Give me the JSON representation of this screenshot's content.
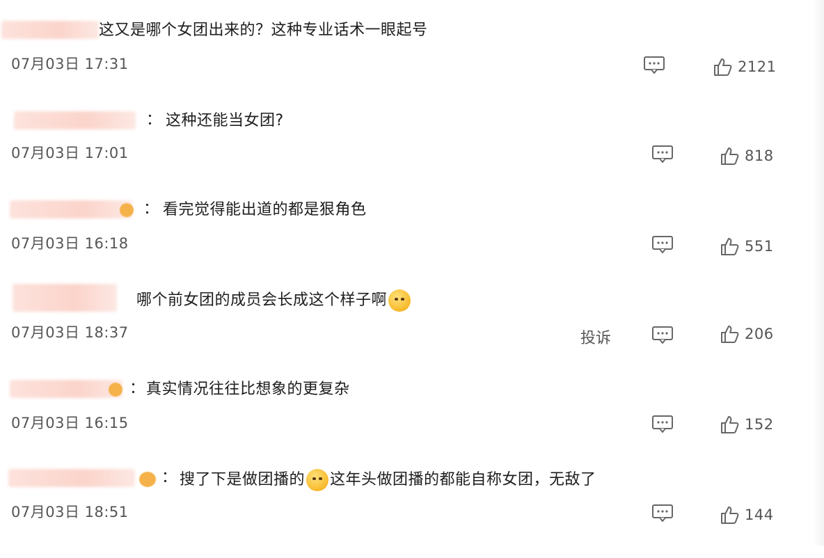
{
  "comments": [
    {
      "text": "这又是哪个女团出来的？这种专业话术一眼起号",
      "timestamp": "07月03日 17:31",
      "likes": "2121"
    },
    {
      "colon": "：",
      "text": "这种还能当女团?",
      "timestamp": "07月03日 17:01",
      "likes": "818"
    },
    {
      "colon": "：",
      "text": "看完觉得能出道的都是狠角色",
      "timestamp": "07月03日 16:18",
      "likes": "551"
    },
    {
      "text": "哪个前女团的成员会长成这个样子啊",
      "timestamp": "07月03日 18:37",
      "report": "投诉",
      "likes": "206"
    },
    {
      "colon": "：",
      "text": "真实情况往往比想象的更复杂",
      "timestamp": "07月03日 16:15",
      "likes": "152"
    },
    {
      "colon": "：",
      "text_part1": "搜了下是做团播的",
      "text_part2": "这年头做团播的都能自称女团，无敌了",
      "timestamp": "07月03日 18:51",
      "likes": "144"
    }
  ],
  "icons": {
    "reply": "comment-bubble-icon",
    "like": "thumbs-up-icon",
    "emoji": "emoji-face-icon"
  }
}
